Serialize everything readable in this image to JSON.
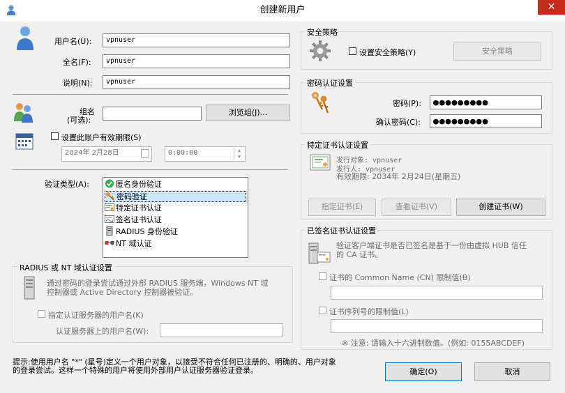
{
  "window": {
    "title": "创建新用户",
    "close_label": "✕"
  },
  "user": {
    "username_label": "用户名(U):",
    "username_value": "vpnuser",
    "fullname_label": "全名(F):",
    "fullname_value": "vpnuser",
    "desc_label": "说明(N):",
    "desc_value": "vpnuser"
  },
  "group": {
    "label_line1": "组名",
    "label_line2": "(可选):",
    "value": "",
    "browse_button": "浏览组(J)..."
  },
  "expiry": {
    "checkbox_label": "设置此账户有效期限(S)",
    "date_value": "2024年 2月28日",
    "time_value": "0:00:00"
  },
  "auth": {
    "type_label": "验证类型(A):",
    "items": [
      {
        "label": "匿名身份验证",
        "icon": "check-circle-icon",
        "selected": false
      },
      {
        "label": "密码验证",
        "icon": "key-icon",
        "selected": true
      },
      {
        "label": "特定证书认证",
        "icon": "certificate-icon",
        "selected": false
      },
      {
        "label": "签名证书认证",
        "icon": "signed-certificate-icon",
        "selected": false
      },
      {
        "label": "RADIUS 身份验证",
        "icon": "server-icon",
        "selected": false
      },
      {
        "label": "NT 域认证",
        "icon": "network-icon",
        "selected": false
      }
    ]
  },
  "radius": {
    "group_title": "RADIUS 或 NT 域认证设置",
    "desc_line1": "通过密码的登录尝试通过外部 RADIUS 服务端，Windows NT 域",
    "desc_line2": "控制器或 Active Directory 控制器被验证。",
    "checkbox_label": "指定认证服务器的用户名(K)",
    "server_user_label": "认证服务器上的用户名(W):",
    "server_user_value": ""
  },
  "security": {
    "group_title": "安全策略",
    "checkbox_label": "设置安全策略(Y)",
    "button": "安全策略"
  },
  "password": {
    "group_title": "密码认证设置",
    "password_label": "密码(P):",
    "password_value": "●●●●●●●●●",
    "confirm_label": "确认密码(C):",
    "confirm_value": "●●●●●●●●●"
  },
  "cert": {
    "group_title": "特定证书认证设置",
    "issued_to": "发行对象: vpnuser",
    "issuer": "发行人: vpnuser",
    "expires": "有效期限: 2034年 2月24日(星期五)",
    "specify_button": "指定证书(E)",
    "view_button": "查看证书(V)",
    "create_button": "创建证书(W)"
  },
  "signed_cert": {
    "group_title": "已签名证书认证设置",
    "desc_line1": "验证客户端证书是否已签名是基于一份由虚拟 HUB 信任",
    "desc_line2": "的 CA 证书。",
    "cn_checkbox_label": "证书的 Common Name (CN) 限制值(B)",
    "cn_value": "",
    "serial_checkbox_label": "证书序列号的限制值(L)",
    "serial_value": "",
    "note": "※ 注意: 请输入十六进制数值。(例如: 0155ABCDEF)"
  },
  "hint": {
    "line1": "提示:使用用户名 \"*\" (星号)定义一个用户对象，以接受不符合任何已注册的、明确的、用户对象",
    "line2": "的登录尝试。这样一个特殊的用户将使用外部用户认证服务器验证登录。"
  },
  "footer": {
    "ok_button": "确定(O)",
    "cancel_button": "取消"
  }
}
